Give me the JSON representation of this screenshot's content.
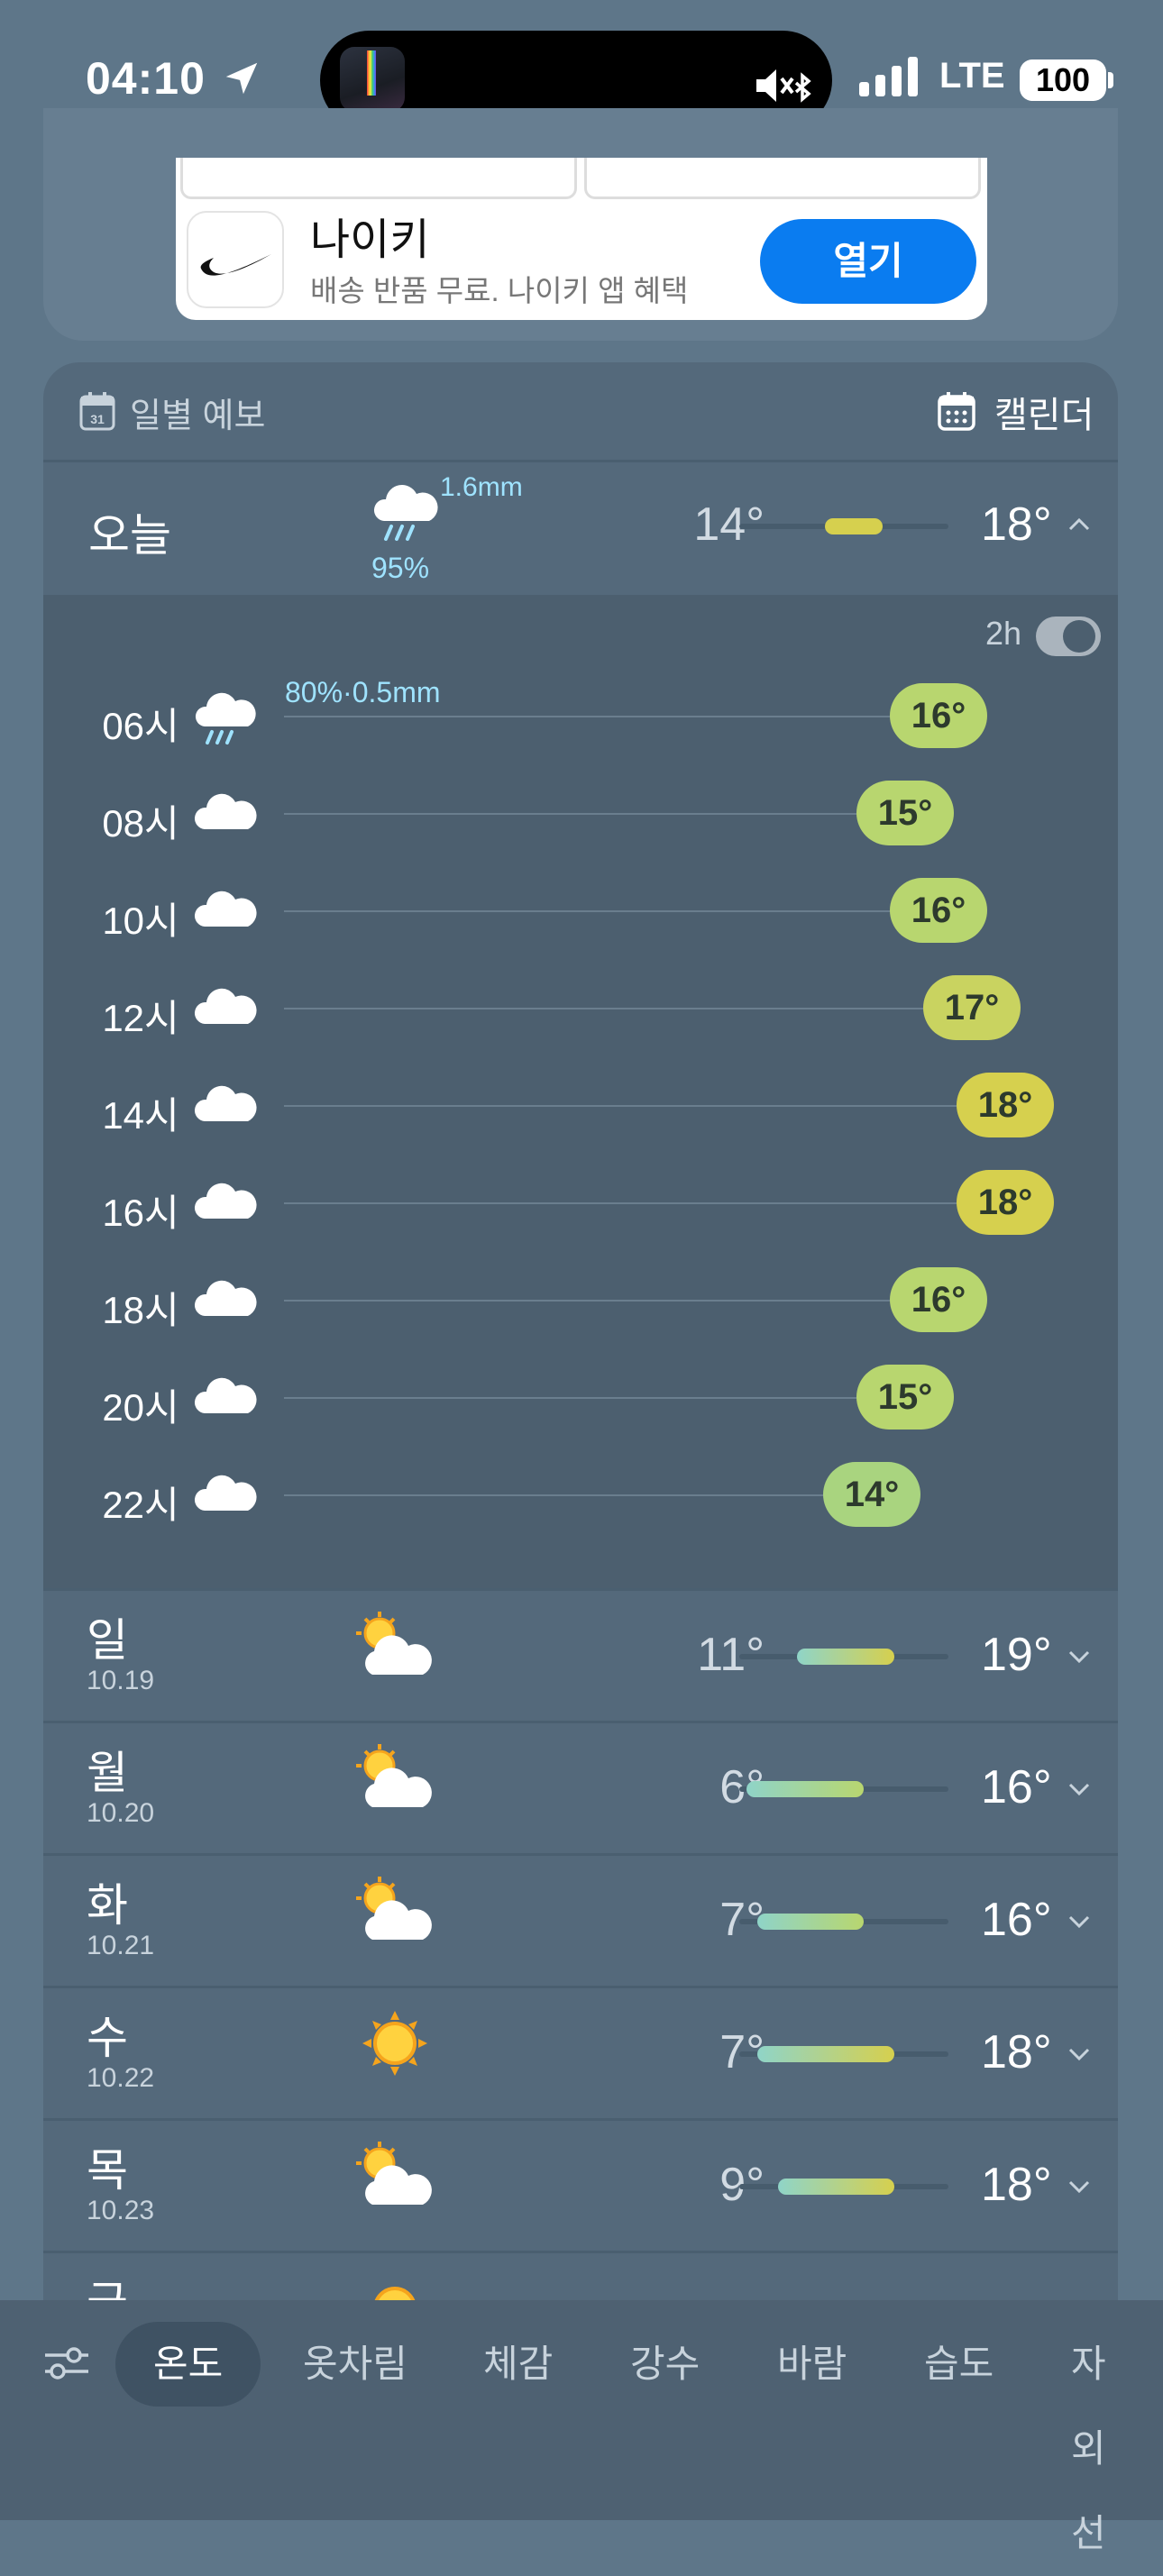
{
  "status": {
    "time": "04:10",
    "network": "LTE",
    "battery": "100"
  },
  "ad": {
    "title": "나이키",
    "subtitle": "배송 반품 무료. 나이키 앱 혜택",
    "button": "열기"
  },
  "header": {
    "title": "일별 예보",
    "calendar_label": "캘린더"
  },
  "today": {
    "label": "오늘",
    "precip_amount": "1.6mm",
    "precip_prob": "95%",
    "low": "14°",
    "high": "18°"
  },
  "hourly_toggle_label": "2h",
  "hourly": [
    {
      "time": "06시",
      "temp": "16°",
      "precip": "80%·0.5mm",
      "icon": "rain-cloud-icon"
    },
    {
      "time": "08시",
      "temp": "15°",
      "icon": "cloud-icon"
    },
    {
      "time": "10시",
      "temp": "16°",
      "icon": "cloud-icon"
    },
    {
      "time": "12시",
      "temp": "17°",
      "icon": "cloud-icon"
    },
    {
      "time": "14시",
      "temp": "18°",
      "icon": "cloud-icon"
    },
    {
      "time": "16시",
      "temp": "18°",
      "icon": "cloud-icon"
    },
    {
      "time": "18시",
      "temp": "16°",
      "icon": "cloud-icon"
    },
    {
      "time": "20시",
      "temp": "15°",
      "icon": "cloud-icon"
    },
    {
      "time": "22시",
      "temp": "14°",
      "icon": "cloud-icon"
    }
  ],
  "days": [
    {
      "name": "일",
      "date": "10.19",
      "low": "11°",
      "high": "19°",
      "icon": "partly-cloudy-icon"
    },
    {
      "name": "월",
      "date": "10.20",
      "low": "6°",
      "high": "16°",
      "icon": "partly-cloudy-icon"
    },
    {
      "name": "화",
      "date": "10.21",
      "low": "7°",
      "high": "16°",
      "icon": "partly-cloudy-icon"
    },
    {
      "name": "수",
      "date": "10.22",
      "low": "7°",
      "high": "18°",
      "icon": "sun-icon"
    },
    {
      "name": "목",
      "date": "10.23",
      "low": "9°",
      "high": "18°",
      "icon": "partly-cloudy-icon"
    },
    {
      "name": "금",
      "date": "",
      "low": "",
      "high": "",
      "icon": "sun-icon"
    }
  ],
  "tabs": [
    "온도",
    "옷차림",
    "체감",
    "강수",
    "바람",
    "습도",
    "자외선"
  ],
  "colors": {
    "warm": "#d6d04e",
    "mild": "#b8d66f",
    "cool": "#8fd4c8"
  }
}
